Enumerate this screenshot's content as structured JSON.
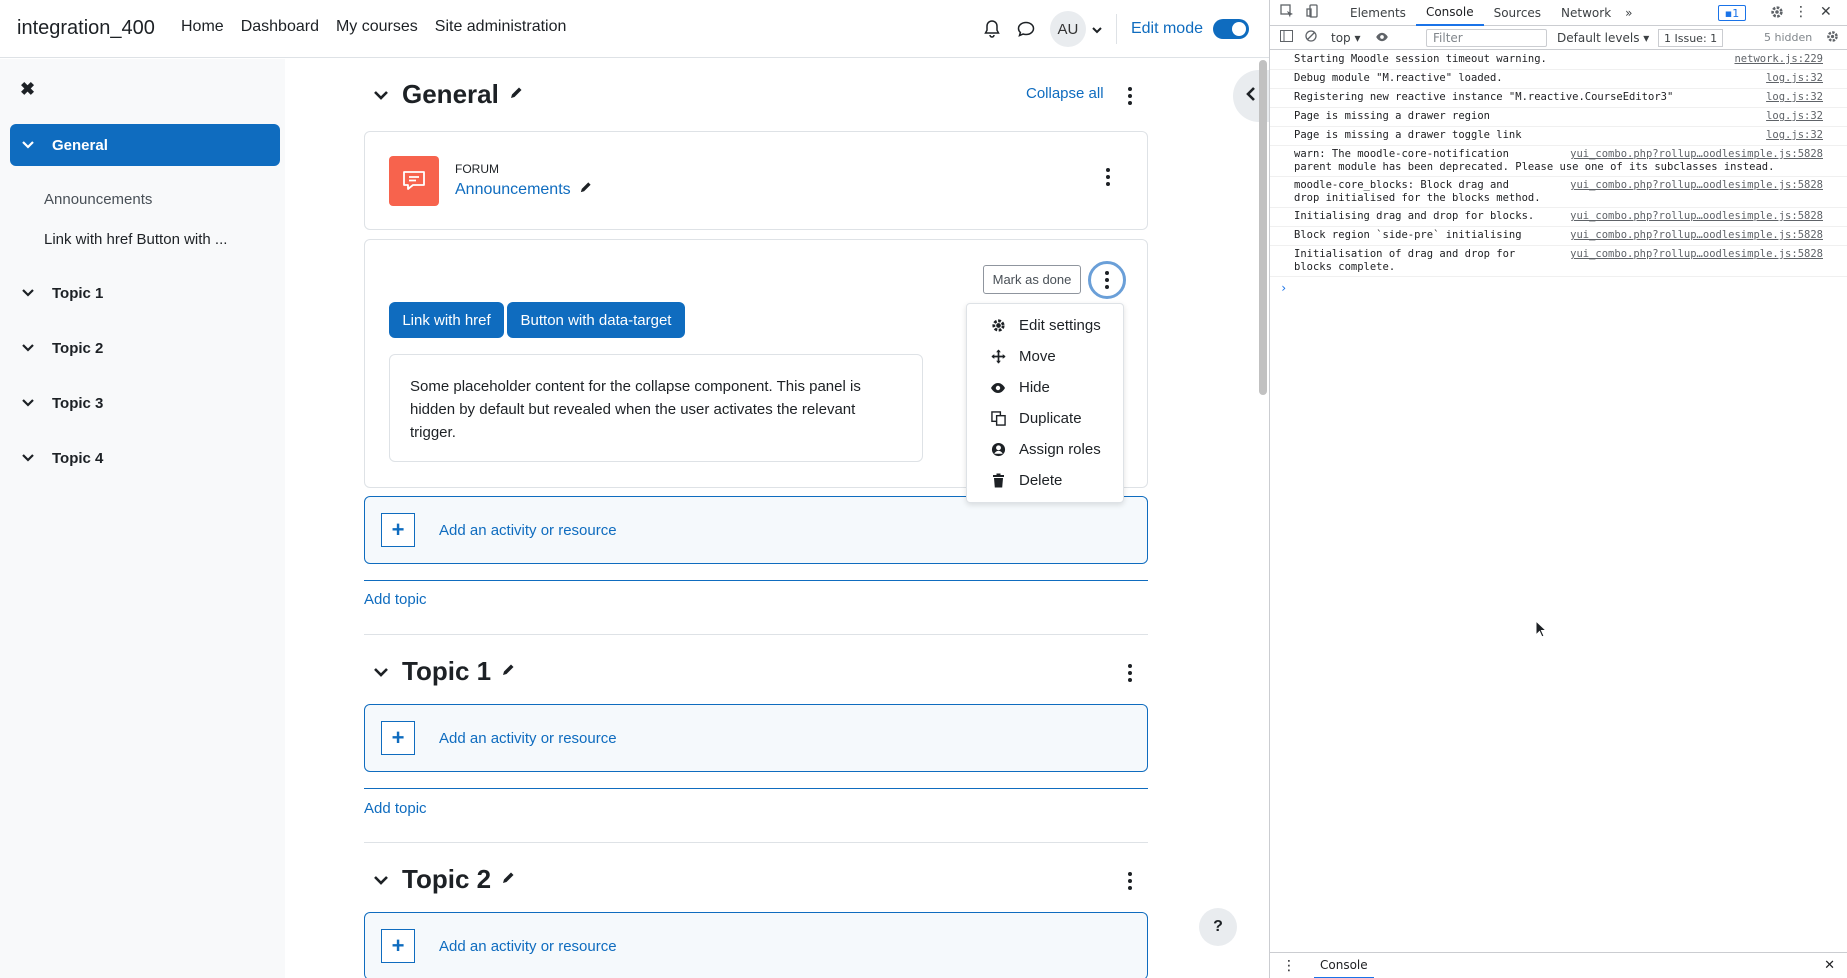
{
  "navbar": {
    "brand": "integration_400",
    "links": [
      "Home",
      "Dashboard",
      "My courses",
      "Site administration"
    ],
    "avatar": "AU",
    "edit_mode_label": "Edit mode"
  },
  "course_index": {
    "sections": [
      {
        "label": "General",
        "active": true,
        "items": [
          "Announcements",
          "Link with href Button with ..."
        ]
      },
      {
        "label": "Topic 1",
        "active": false,
        "items": []
      },
      {
        "label": "Topic 2",
        "active": false,
        "items": []
      },
      {
        "label": "Topic 3",
        "active": false,
        "items": []
      },
      {
        "label": "Topic 4",
        "active": false,
        "items": []
      }
    ]
  },
  "main": {
    "general_title": "General",
    "collapse_all": "Collapse all",
    "forum": {
      "type": "Forum",
      "name": "Announcements"
    },
    "label_module": {
      "mark_done": "Mark as done",
      "btn_link": "Link with href",
      "btn_target": "Button with data-target",
      "panel_text": "Some placeholder content for the collapse component. This panel is hidden by default but revealed when the user activates the relevant trigger."
    },
    "add_activity": "Add an activity or resource",
    "add_topic": "Add topic",
    "topic1_title": "Topic 1",
    "topic2_title": "Topic 2",
    "help": "?"
  },
  "action_menu": {
    "items": [
      {
        "label": "Edit settings",
        "icon": "gear-icon"
      },
      {
        "label": "Move",
        "icon": "move-icon"
      },
      {
        "label": "Hide",
        "icon": "eye-icon"
      },
      {
        "label": "Duplicate",
        "icon": "copy-icon"
      },
      {
        "label": "Assign roles",
        "icon": "user-icon"
      },
      {
        "label": "Delete",
        "icon": "trash-icon"
      }
    ]
  },
  "devtools": {
    "tabs": [
      "Elements",
      "Console",
      "Sources",
      "Network"
    ],
    "issue_badge": "1",
    "context": "top",
    "filter_placeholder": "Filter",
    "levels": "Default levels",
    "issues": "1 Issue: 1",
    "hidden": "5 hidden",
    "logs": [
      {
        "msg": "Starting Moodle session timeout warning.",
        "src": "network.js:229",
        "wide": true
      },
      {
        "msg": "Debug module \"M.reactive\" loaded.",
        "src": "log.js:32",
        "wide": true
      },
      {
        "msg": "Registering new reactive instance \"M.reactive.CourseEditor3\"",
        "src": "log.js:32",
        "wide": true
      },
      {
        "msg": "Page is missing a drawer region",
        "src": "log.js:32",
        "wide": true
      },
      {
        "msg": "Page is missing a drawer toggle link",
        "src": "log.js:32",
        "wide": true
      },
      {
        "msg": "warn: The moodle-core-notification\nparent module has been deprecated. Please use one of its subclasses instead.",
        "src": "yui_combo.php?rollup…oodlesimple.js:5828",
        "wide": true
      },
      {
        "msg": "moodle-core_blocks: Block drag and\ndrop initialised for the blocks method.",
        "src": "yui_combo.php?rollup…oodlesimple.js:5828",
        "wide": true
      },
      {
        "msg": "Initialising drag and drop for blocks.",
        "src": "yui_combo.php?rollup…oodlesimple.js:5828",
        "wide": false
      },
      {
        "msg": "Block region `side-pre` initialising",
        "src": "yui_combo.php?rollup…oodlesimple.js:5828",
        "wide": false
      },
      {
        "msg": "Initialisation of drag and drop for\nblocks complete.",
        "src": "yui_combo.php?rollup…oodlesimple.js:5828",
        "wide": false
      }
    ],
    "bottom_tab": "Console"
  }
}
